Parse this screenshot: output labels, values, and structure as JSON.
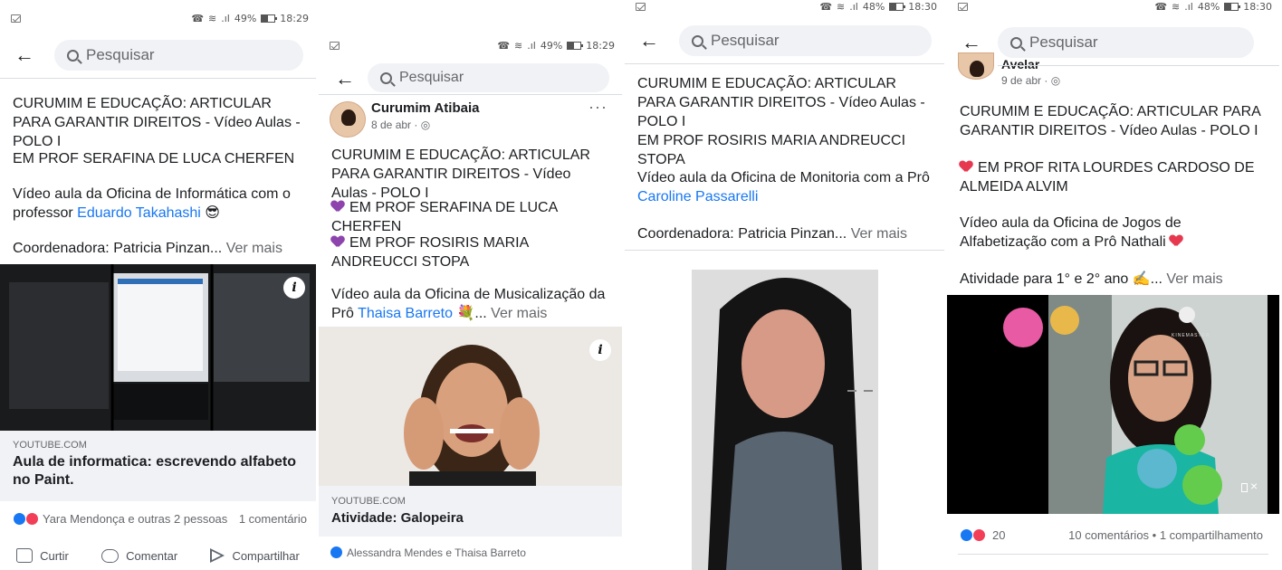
{
  "panels": [
    {
      "status": {
        "battery": "49%",
        "time": "18:29"
      },
      "search_placeholder": "Pesquisar",
      "title": "CURUMIM E EDUCAÇÃO: ARTICULAR PARA GARANTIR DIREITOS - Vídeo Aulas - POLO I",
      "school": "EM PROF SERAFINA DE LUCA CHERFEN",
      "desc_prefix": "Vídeo aula da Oficina de Informática com o professor ",
      "desc_link": "Eduardo Takahashi",
      "desc_emoji": "😎",
      "coord": "Coordenadora: Patricia Pinzan...",
      "see_more": "Ver mais",
      "link_domain": "YOUTUBE.COM",
      "link_title": "Aula de informatica: escrevendo alfabeto no Paint.",
      "reactions_text": "Yara Mendonça e outras 2 pessoas",
      "comments_text": "1 comentário",
      "actions": {
        "like": "Curtir",
        "comment": "Comentar",
        "share": "Compartilhar"
      }
    },
    {
      "status": {
        "battery": "49%",
        "time": "18:29"
      },
      "search_placeholder": "Pesquisar",
      "author": "Curumim Atibaia",
      "date": "8 de abr · ",
      "more_dots": "···",
      "title": "CURUMIM E EDUCAÇÃO: ARTICULAR PARA GARANTIR DIREITOS - Vídeo Aulas - POLO I",
      "school1": "EM PROF SERAFINA DE LUCA CHERFEN",
      "school2": "EM PROF ROSIRIS MARIA ANDREUCCI STOPA",
      "desc_prefix": "Vídeo aula da Oficina de Musicalização da Prô ",
      "desc_link": "Thaisa Barreto",
      "desc_emoji": "💐...",
      "see_more": "Ver mais",
      "link_domain": "YOUTUBE.COM",
      "link_title": "Atividade: Galopeira",
      "reactions_text": "Alessandra Mendes e Thaisa Barreto"
    },
    {
      "status": {
        "battery": "48%",
        "time": "18:30"
      },
      "search_placeholder": "Pesquisar",
      "title": "CURUMIM E EDUCAÇÃO: ARTICULAR PARA GARANTIR DIREITOS - Vídeo Aulas - POLO I",
      "school": "EM PROF ROSIRIS MARIA ANDREUCCI STOPA",
      "desc_prefix": "Vídeo aula da Oficina de Monitoria com a Prô ",
      "desc_link": "Caroline Passarelli",
      "coord": "Coordenadora: Patricia Pinzan...",
      "see_more": "Ver mais"
    },
    {
      "status": {
        "battery": "48%",
        "time": "18:30"
      },
      "search_placeholder": "Pesquisar",
      "author_partial": "Avelar",
      "date": "9 de abr · ",
      "title": "CURUMIM E EDUCAÇÃO: ARTICULAR PARA GARANTIR DIREITOS - Vídeo Aulas - POLO I",
      "school": "EM PROF RITA LOURDES CARDOSO DE ALMEIDA ALVIM",
      "desc": "Vídeo aula da Oficina de Jogos de Alfabetização com a Prô Nathali",
      "activity": "Atividade para 1° e 2° ano ✍️...",
      "see_more": "Ver mais",
      "video_watermark": "KINEMASTER",
      "reaction_count": "20",
      "comments_shares": "10 comentários • 1 compartilhamento"
    }
  ],
  "colors": {
    "link": "#1877f2",
    "like": "#1877f2",
    "love": "#f33e58",
    "purple_heart": "#8e44ad"
  }
}
